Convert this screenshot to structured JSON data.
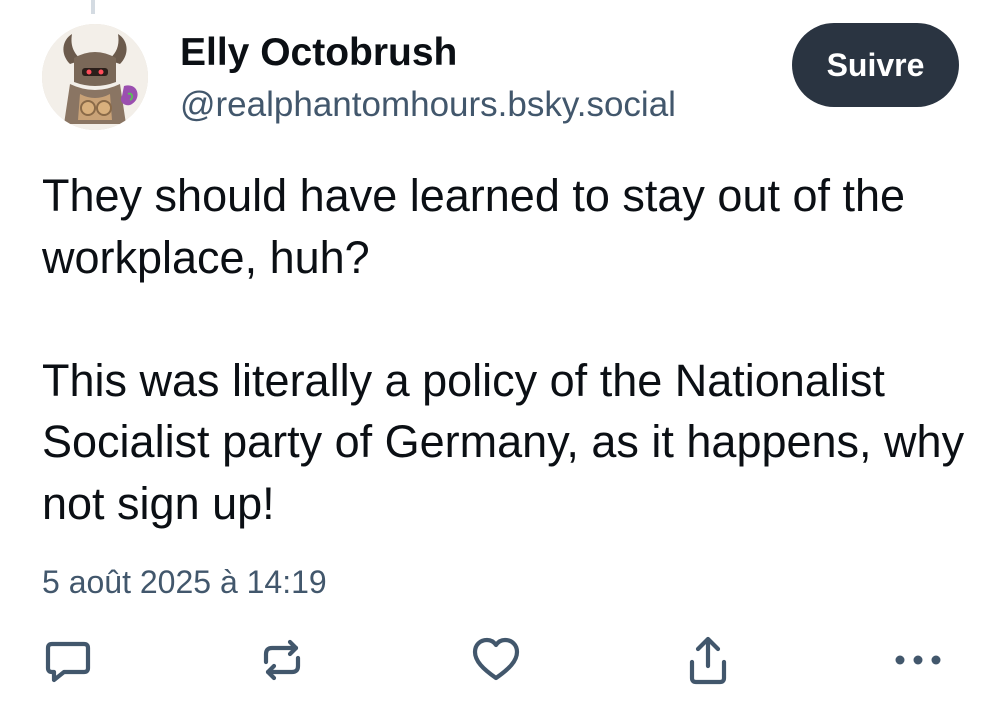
{
  "post": {
    "author": {
      "display_name": "Elly Octobrush",
      "handle": "@realphantomhours.bsky.social",
      "avatar_icon": "avatar-image"
    },
    "follow_label": "Suivre",
    "body": [
      "They should have learned to stay out of the workplace, huh?",
      "This was literally a policy of the Nationalist Socialist party of Germany, as it happens, why not sign up!"
    ],
    "timestamp": "5 août 2025 à 14:19"
  },
  "actions": [
    {
      "icon": "reply-icon"
    },
    {
      "icon": "repost-icon"
    },
    {
      "icon": "like-icon"
    },
    {
      "icon": "share-icon"
    },
    {
      "icon": "more-icon"
    }
  ],
  "colors": {
    "text": "#0b0f14",
    "muted": "#42576c",
    "follow_button_bg": "#2a3441",
    "icon_stroke": "#42576c"
  }
}
